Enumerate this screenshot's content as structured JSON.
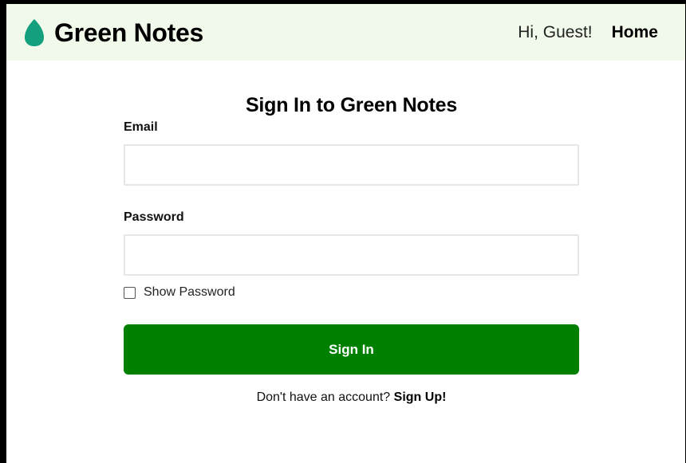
{
  "colors": {
    "navbar_bg": "#f1f9ea",
    "leaf": "#13a07e",
    "button_bg": "#008000",
    "button_text": "#ffffff"
  },
  "navbar": {
    "brand_icon": "leaf-icon",
    "brand_name": "Green Notes",
    "greeting": "Hi, Guest!",
    "home_label": "Home"
  },
  "form": {
    "title": "Sign In to Green Notes",
    "email_label": "Email",
    "email_value": "",
    "password_label": "Password",
    "password_value": "",
    "show_password_label": "Show Password",
    "show_password_checked": false,
    "submit_label": "Sign In",
    "signup_prompt": "Don't have an account?",
    "signup_link": "Sign Up!"
  }
}
